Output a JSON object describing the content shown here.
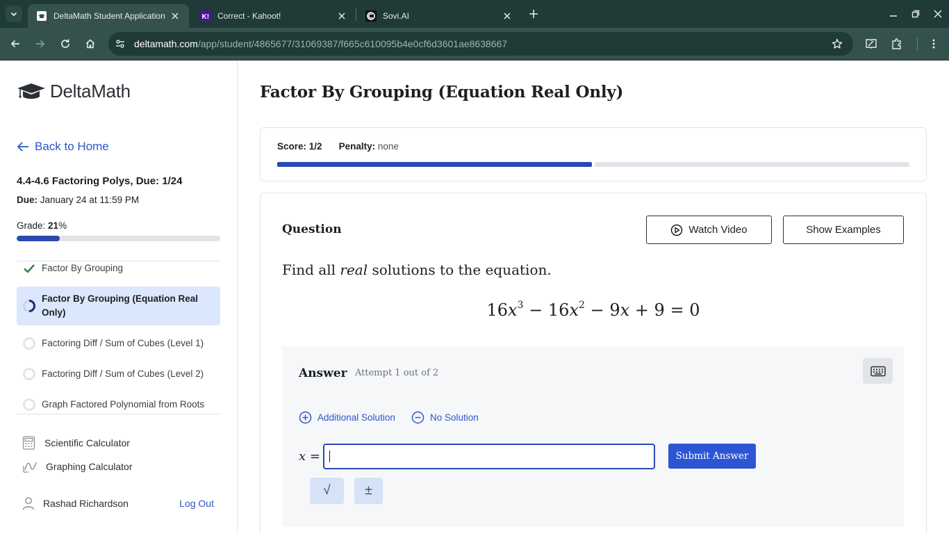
{
  "browser": {
    "tabs": [
      {
        "title": "DeltaMath Student Application",
        "favicon": "deltamath-favicon",
        "active": true
      },
      {
        "title": "Correct - Kahoot!",
        "favicon": "kahoot-favicon",
        "favicon_text": "K!",
        "active": false
      },
      {
        "title": "Sovi.AI",
        "favicon": "sovi-favicon",
        "active": false
      }
    ],
    "url_host": "deltamath.com",
    "url_path": "/app/student/4865677/31069387/f665c610095b4e0cf6d3601ae8638667",
    "colors": {
      "tabbar": "#1f3a37",
      "toolbar": "#35514d"
    }
  },
  "sidebar": {
    "logo_text": "DeltaMath",
    "back_label": "Back to Home",
    "assignment_title": "4.4-4.6 Factoring Polys, Due: 1/24",
    "due_label": "Due:",
    "due_value": "January 24 at 11:59 PM",
    "grade_label": "Grade:",
    "grade_value": "21",
    "grade_suffix": "%",
    "grade_fraction": 0.21,
    "problems": [
      {
        "label": "Factor By Grouping",
        "status": "complete"
      },
      {
        "label": "Factor By Grouping (Equation Real Only)",
        "status": "in-progress"
      },
      {
        "label": "Factoring Diff / Sum of Cubes (Level 1)",
        "status": "not-started"
      },
      {
        "label": "Factoring Diff / Sum of Cubes (Level 2)",
        "status": "not-started"
      },
      {
        "label": "Graph Factored Polynomial from Roots",
        "status": "not-started"
      }
    ],
    "tools": [
      {
        "label": "Scientific Calculator",
        "icon": "calculator-icon"
      },
      {
        "label": "Graphing Calculator",
        "icon": "graph-icon"
      }
    ],
    "user_name": "Rashad Richardson",
    "logout_label": "Log Out"
  },
  "main": {
    "title": "Factor By Grouping (Equation Real Only)",
    "score_label": "Score:",
    "score_value": "1/2",
    "penalty_label": "Penalty:",
    "penalty_value": "none",
    "score_done": 1,
    "score_total": 2,
    "question_label": "Question",
    "watch_video_label": "Watch Video",
    "show_examples_label": "Show Examples",
    "prompt_before": "Find all ",
    "prompt_emph": "real",
    "prompt_after": " solutions to the equation.",
    "equation": {
      "t1_coef": "16",
      "t1_var": "x",
      "t1_exp": "3",
      "op1": "−",
      "t2_coef": "16",
      "t2_var": "x",
      "t2_exp": "2",
      "op2": "−",
      "t3_coef": "9",
      "t3_var": "x",
      "op3": "+",
      "t4": "9",
      "eq": "=",
      "rhs": "0"
    },
    "answer_label": "Answer",
    "attempt_text": "Attempt 1 out of 2",
    "additional_solution_label": "Additional Solution",
    "no_solution_label": "No Solution",
    "answer_var": "x",
    "answer_eq": "=",
    "answer_value": "",
    "submit_label": "Submit Answer",
    "sqrt_symbol": "√",
    "plusminus_symbol": "±",
    "accent_color": "#2c55d4"
  }
}
